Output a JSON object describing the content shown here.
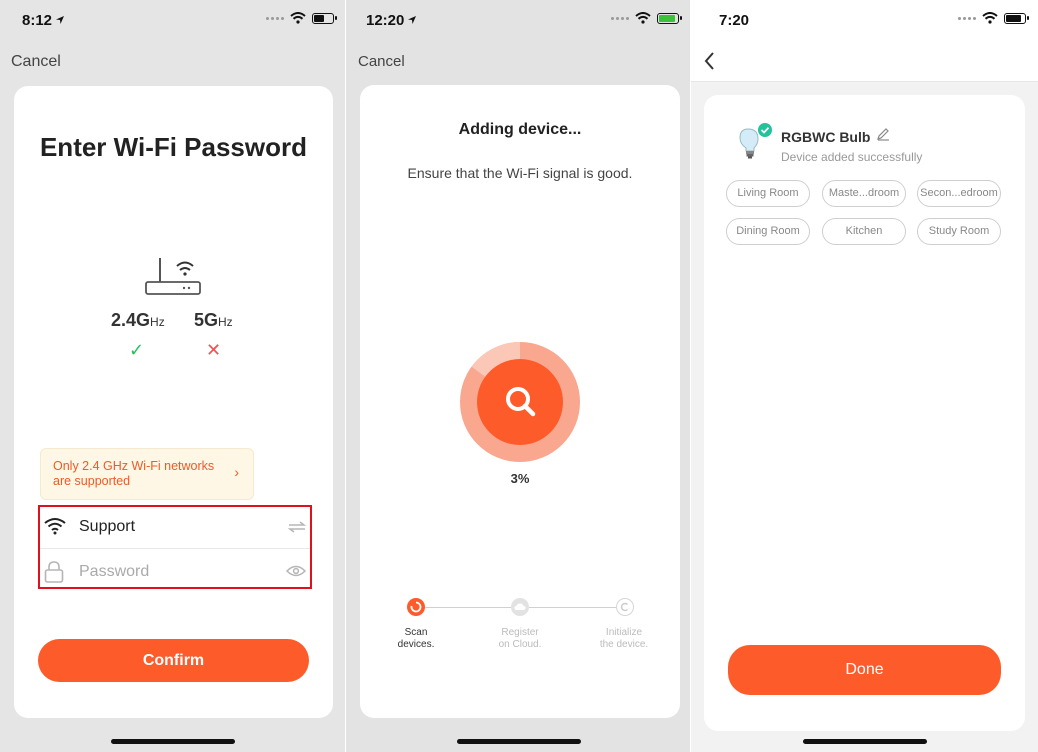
{
  "screens": [
    {
      "status_time": "8:12",
      "cancel_label": "Cancel",
      "title": "Enter Wi-Fi Password",
      "band_24_main": "2.4G",
      "band_24_unit": "Hz",
      "band_5_main": "5G",
      "band_5_unit": "Hz",
      "band_24_mark": "✓",
      "band_5_mark": "✕",
      "notice_line1": "Only 2.4 GHz Wi-Fi networks",
      "notice_line2": "are supported",
      "notice_chevron": "›",
      "wifi_name": "Support",
      "password_placeholder": "Password",
      "password_value": "",
      "confirm_label": "Confirm",
      "icons": [
        "location-arrow-icon",
        "wifi-icon",
        "battery-icon",
        "router-icon",
        "wifi-icon",
        "switch-network-icon",
        "lock-icon",
        "eye-icon"
      ]
    },
    {
      "status_time": "12:20",
      "cancel_label": "Cancel",
      "title": "Adding device...",
      "subtitle": "Ensure that the Wi-Fi signal is good.",
      "progress_label": "3%",
      "progress": 0.03,
      "steps": [
        {
          "line1": "Scan",
          "line2": "devices.",
          "state": "active"
        },
        {
          "line1": "Register",
          "line2": "on Cloud.",
          "state": "pending"
        },
        {
          "line1": "Initialize",
          "line2": "the device.",
          "state": "pending"
        }
      ],
      "icons": [
        "search-icon",
        "cloud-icon",
        "initialize-icon",
        "battery-charging-icon"
      ]
    },
    {
      "status_time": "7:20",
      "device_name": "RGBWC Bulb",
      "device_status": "Device added successfully",
      "rooms": [
        "Living Room",
        "Maste...droom",
        "Secon...edroom",
        "Dining Room",
        "Kitchen",
        "Study Room"
      ],
      "done_label": "Done",
      "icons": [
        "back-chevron-icon",
        "bulb-icon",
        "check-badge-icon",
        "pencil-icon"
      ]
    }
  ],
  "colors": {
    "accent": "#fd5b2a",
    "success": "#22c35e",
    "error": "#f05252",
    "highlight_border": "#e0101d",
    "notice_bg": "#fef7e6"
  }
}
